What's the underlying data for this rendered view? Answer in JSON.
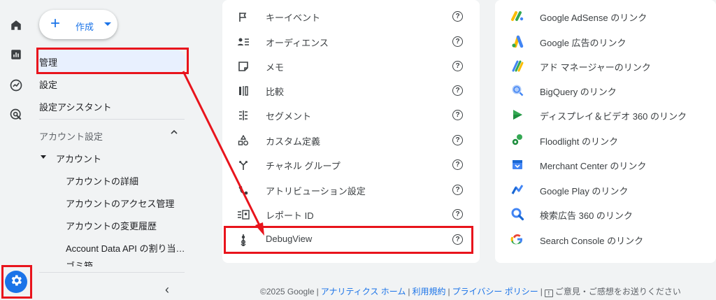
{
  "nav": {
    "create_label": "作成",
    "items": [
      "管理",
      "設定",
      "設定アシスタント"
    ],
    "section_label": "アカウント設定",
    "account_label": "アカウント",
    "sub_items": [
      "アカウントの詳細",
      "アカウントのアクセス管理",
      "アカウントの変更履歴",
      "Account Data API の割り当…",
      "ゴミ箱"
    ]
  },
  "settings_card": {
    "rows": [
      {
        "label": "キーイベント",
        "icon": "flag-icon"
      },
      {
        "label": "オーディエンス",
        "icon": "audience-icon"
      },
      {
        "label": "メモ",
        "icon": "note-icon"
      },
      {
        "label": "比較",
        "icon": "compare-icon"
      },
      {
        "label": "セグメント",
        "icon": "segment-icon"
      },
      {
        "label": "カスタム定義",
        "icon": "custom-definitions-icon"
      },
      {
        "label": "チャネル グループ",
        "icon": "channel-group-icon"
      },
      {
        "label": "アトリビューション設定",
        "icon": "attribution-icon"
      },
      {
        "label": "レポート ID",
        "icon": "report-id-icon"
      },
      {
        "label": "DebugView",
        "icon": "debugview-icon"
      }
    ],
    "help_glyph": "?"
  },
  "links_card": {
    "rows": [
      {
        "label": "Google AdSense のリンク",
        "icon": "adsense-icon"
      },
      {
        "label": "Google 広告のリンク",
        "icon": "google-ads-icon"
      },
      {
        "label": "アド マネージャーのリンク",
        "icon": "ad-manager-icon"
      },
      {
        "label": "BigQuery のリンク",
        "icon": "bigquery-icon"
      },
      {
        "label": "ディスプレイ＆ビデオ 360 のリンク",
        "icon": "display-video-360-icon"
      },
      {
        "label": "Floodlight のリンク",
        "icon": "floodlight-icon"
      },
      {
        "label": "Merchant Center のリンク",
        "icon": "merchant-center-icon"
      },
      {
        "label": "Google Play のリンク",
        "icon": "google-play-icon"
      },
      {
        "label": "検索広告 360 のリンク",
        "icon": "search-ads-360-icon"
      },
      {
        "label": "Search Console のリンク",
        "icon": "search-console-icon"
      }
    ]
  },
  "footer": {
    "copyright": "©2025 Google",
    "links": [
      "アナリティクス ホーム",
      "利用規約",
      "プライバシー ポリシー"
    ],
    "feedback": "ご意見・ご感想をお送りください"
  },
  "colors": {
    "accent": "#1a73e8",
    "highlight": "#e8141c"
  }
}
